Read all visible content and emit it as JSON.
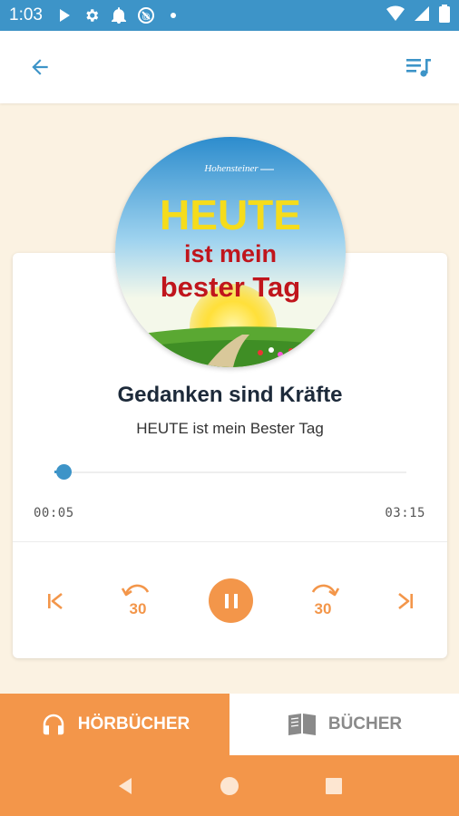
{
  "status_bar": {
    "time": "1:03",
    "icons": [
      "play-icon",
      "settings-icon",
      "notification-bell-icon",
      "blocked-circle-icon",
      "dot-icon",
      "wifi-icon",
      "signal-icon",
      "battery-icon"
    ]
  },
  "app_bar": {
    "back_icon": "arrow-back-icon",
    "queue_icon": "queue-music-icon"
  },
  "cover": {
    "logo_text": "Hohensteiner",
    "line1": "HEUTE",
    "line2": "ist mein",
    "line3": "bester Tag"
  },
  "track": {
    "title": "Gedanken sind Kräfte",
    "subtitle": "HEUTE ist mein Bester Tag"
  },
  "progress": {
    "current": "00:05",
    "total": "03:15",
    "fraction": 0.026
  },
  "controls": {
    "previous_icon": "skip-previous-icon",
    "rewind_icon": "replay-30-icon",
    "rewind_label": "30",
    "pause_icon": "pause-icon",
    "forward_icon": "forward-30-icon",
    "forward_label": "30",
    "next_icon": "skip-next-icon"
  },
  "tabs": [
    {
      "label": "HÖRBÜCHER",
      "icon": "headphones-icon",
      "active": true
    },
    {
      "label": "BÜCHER",
      "icon": "book-icon",
      "active": false
    }
  ],
  "nav_bar": {
    "back_icon": "nav-back-icon",
    "home_icon": "nav-home-icon",
    "recents_icon": "nav-recents-icon"
  },
  "colors": {
    "accent": "#f3964a",
    "primary": "#3d94c8",
    "background": "#fbf2e2"
  }
}
